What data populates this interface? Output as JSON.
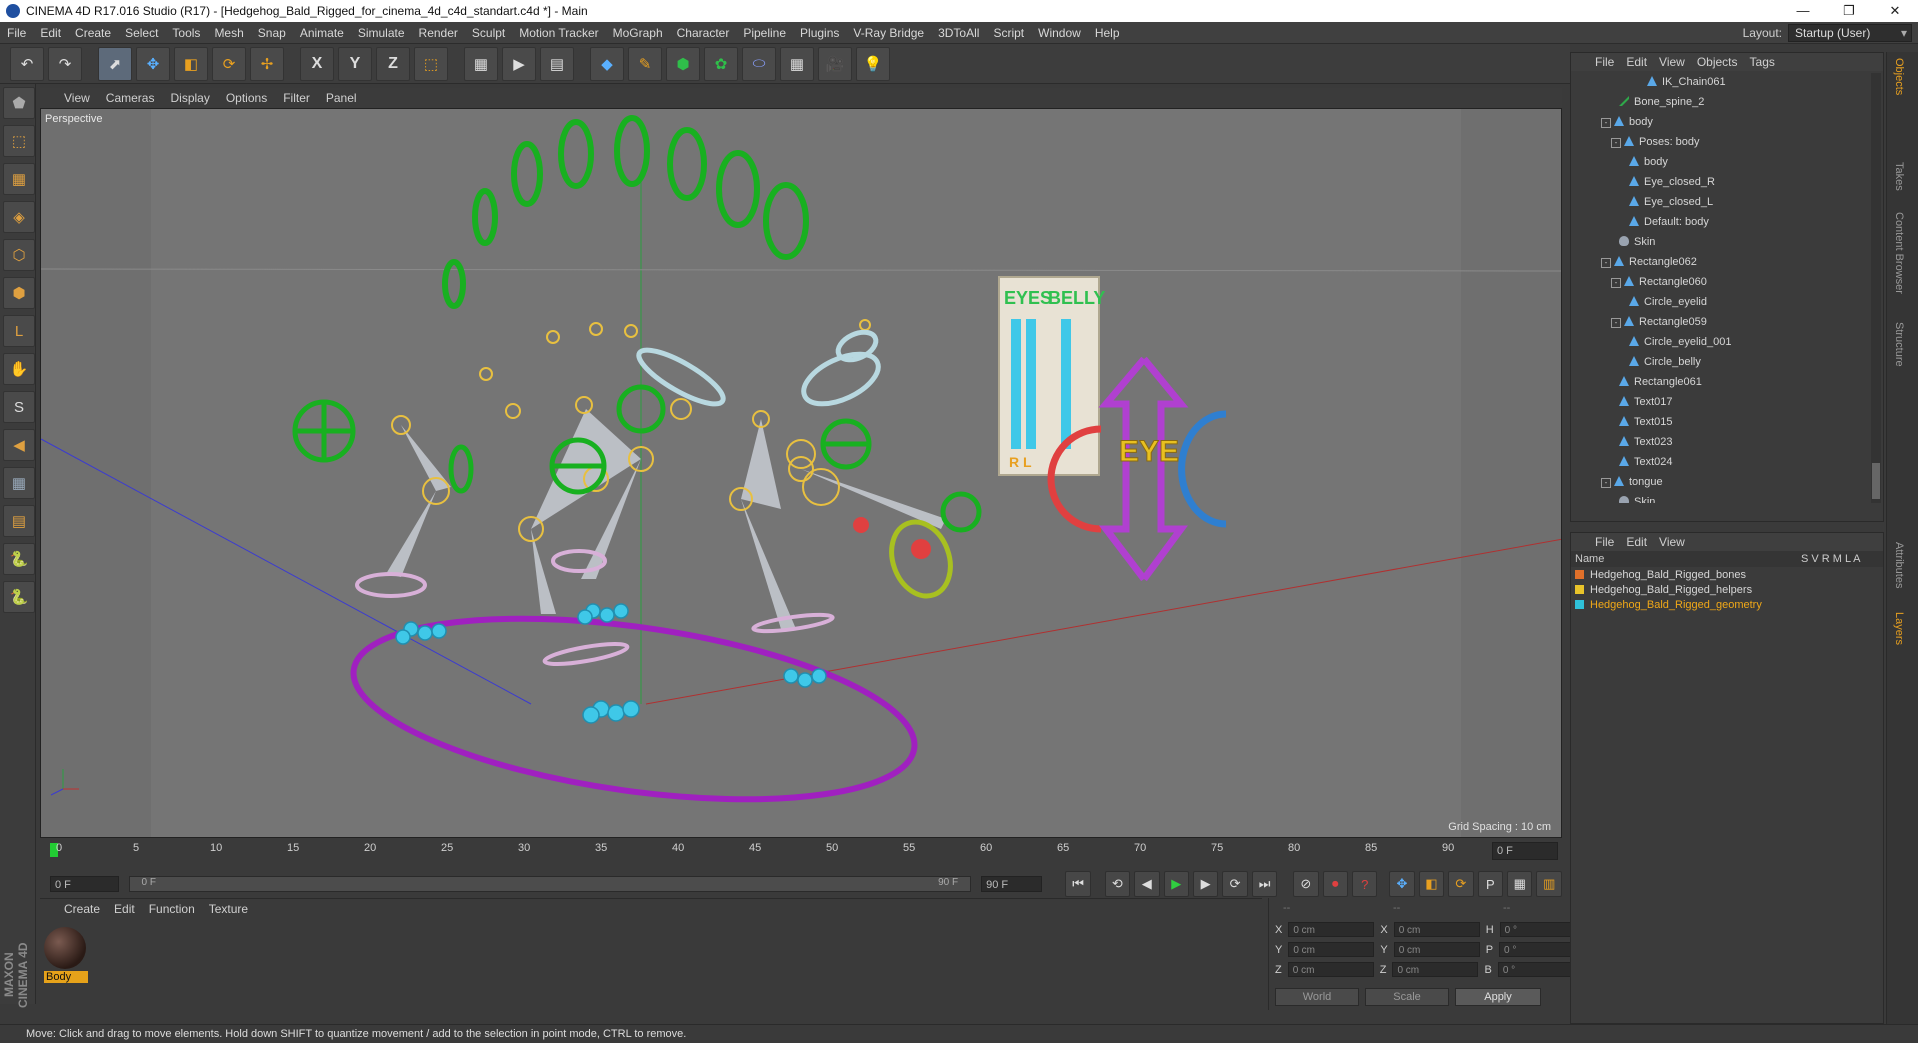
{
  "window": {
    "title": "CINEMA 4D R17.016 Studio (R17) - [Hedgehog_Bald_Rigged_for_cinema_4d_c4d_standart.c4d *] - Main",
    "controls": [
      "—",
      "❐",
      "✕"
    ]
  },
  "menubar": {
    "items": [
      "File",
      "Edit",
      "Create",
      "Select",
      "Tools",
      "Mesh",
      "Snap",
      "Animate",
      "Simulate",
      "Render",
      "Sculpt",
      "Motion Tracker",
      "MoGraph",
      "Character",
      "Pipeline",
      "Plugins",
      "V-Ray Bridge",
      "3DToAll",
      "Script",
      "Window",
      "Help"
    ],
    "layout_label": "Layout:",
    "layout_value": "Startup (User)"
  },
  "toolbar": {
    "undo": "↶",
    "redo": "↷",
    "tools": [
      "⬈",
      "✥",
      "◧",
      "⟳",
      "✢"
    ],
    "axes": [
      "X",
      "Y",
      "Z"
    ],
    "coord": "⬚",
    "render": [
      "▦",
      "▶",
      "▤"
    ],
    "objects": [
      "◆",
      "✎",
      "⬢",
      "✿",
      "⬭",
      "▦",
      "🎥",
      "💡"
    ]
  },
  "lefttools": [
    "⬟",
    "⬚",
    "▦",
    "◈",
    "⬡",
    "⬢",
    "L",
    "✋",
    "S",
    "◀",
    "▦",
    "▤",
    "🐍",
    "🐍"
  ],
  "viewport": {
    "menu": [
      "View",
      "Cameras",
      "Display",
      "Options",
      "Filter",
      "Panel"
    ],
    "label": "Perspective",
    "grid_spacing": "Grid Spacing : 10 cm",
    "text_eyes": "EYES",
    "text_belly": "BELLY",
    "text_eye": "EYE",
    "text_rl": "R L"
  },
  "timeline": {
    "ticks": [
      "0",
      "5",
      "10",
      "15",
      "20",
      "25",
      "30",
      "35",
      "40",
      "45",
      "50",
      "55",
      "60",
      "65",
      "70",
      "75",
      "80",
      "85",
      "90"
    ],
    "current_frame": "0 F",
    "start_field": "0 F",
    "slider_start": "0 F",
    "slider_end": "90 F",
    "end_field": "90 F",
    "transport": [
      "⏮",
      "⟲",
      "◀",
      "▶",
      "▶",
      "⟳",
      "⏭"
    ],
    "extra": [
      "⊘",
      "⏺",
      "?",
      "✥",
      "◧",
      "⟳",
      "P",
      "▦",
      "▥"
    ]
  },
  "material": {
    "menu": [
      "Create",
      "Edit",
      "Function",
      "Texture"
    ],
    "items": [
      {
        "name": "Body"
      }
    ]
  },
  "coordinates": {
    "headers": [
      "--",
      "--",
      "--"
    ],
    "rows": [
      {
        "a": "X",
        "av": "0 cm",
        "b": "X",
        "bv": "0 cm",
        "c": "H",
        "cv": "0 °"
      },
      {
        "a": "Y",
        "av": "0 cm",
        "b": "Y",
        "bv": "0 cm",
        "c": "P",
        "cv": "0 °"
      },
      {
        "a": "Z",
        "av": "0 cm",
        "b": "Z",
        "bv": "0 cm",
        "c": "B",
        "cv": "0 °"
      }
    ],
    "mode": "World",
    "scale": "Scale",
    "apply": "Apply"
  },
  "status": "Move: Click and drag to move elements. Hold down SHIFT to quantize movement / add to the selection in point mode, CTRL to remove.",
  "maxon": "MAXON CINEMA 4D",
  "objectmanager": {
    "menu": [
      "File",
      "Edit",
      "View",
      "Objects",
      "Tags"
    ],
    "items": [
      {
        "name": "IK_Chain061",
        "indent": 70,
        "icon": "ik"
      },
      {
        "name": "Bone_spine_2",
        "indent": 42,
        "icon": "bone"
      },
      {
        "name": "body",
        "indent": 24,
        "icon": "obj",
        "exp": true
      },
      {
        "name": "Poses: body",
        "indent": 34,
        "icon": "ik",
        "exp": true
      },
      {
        "name": "body",
        "indent": 52,
        "icon": "obj"
      },
      {
        "name": "Eye_closed_R",
        "indent": 52,
        "icon": "obj"
      },
      {
        "name": "Eye_closed_L",
        "indent": 52,
        "icon": "obj"
      },
      {
        "name": "Default: body",
        "indent": 52,
        "icon": "obj"
      },
      {
        "name": "Skin",
        "indent": 42,
        "icon": "skin"
      },
      {
        "name": "Rectangle062",
        "indent": 24,
        "icon": "obj",
        "exp": true
      },
      {
        "name": "Rectangle060",
        "indent": 34,
        "icon": "obj",
        "exp": true
      },
      {
        "name": "Circle_eyelid",
        "indent": 52,
        "icon": "obj"
      },
      {
        "name": "Rectangle059",
        "indent": 34,
        "icon": "obj",
        "exp": true
      },
      {
        "name": "Circle_eyelid_001",
        "indent": 52,
        "icon": "obj"
      },
      {
        "name": "Circle_belly",
        "indent": 52,
        "icon": "obj"
      },
      {
        "name": "Rectangle061",
        "indent": 42,
        "icon": "obj"
      },
      {
        "name": "Text017",
        "indent": 42,
        "icon": "obj"
      },
      {
        "name": "Text015",
        "indent": 42,
        "icon": "obj"
      },
      {
        "name": "Text023",
        "indent": 42,
        "icon": "obj"
      },
      {
        "name": "Text024",
        "indent": 42,
        "icon": "obj"
      },
      {
        "name": "tongue",
        "indent": 24,
        "icon": "obj",
        "exp": true
      },
      {
        "name": "Skin",
        "indent": 42,
        "icon": "skin"
      }
    ]
  },
  "layermanager": {
    "menu": [
      "File",
      "Edit",
      "View"
    ],
    "columns": {
      "name": "Name",
      "flags": "S V R M L A"
    },
    "layers": [
      {
        "name": "Hedgehog_Bald_Rigged_bones",
        "color": "#e0702a"
      },
      {
        "name": "Hedgehog_Bald_Rigged_helpers",
        "color": "#e8c32a"
      },
      {
        "name": "Hedgehog_Bald_Rigged_geometry",
        "color": "#2fc0d8"
      }
    ]
  },
  "righttabs": [
    "Objects",
    "Takes",
    "Content Browser",
    "Structure",
    "Attributes",
    "Layers"
  ]
}
